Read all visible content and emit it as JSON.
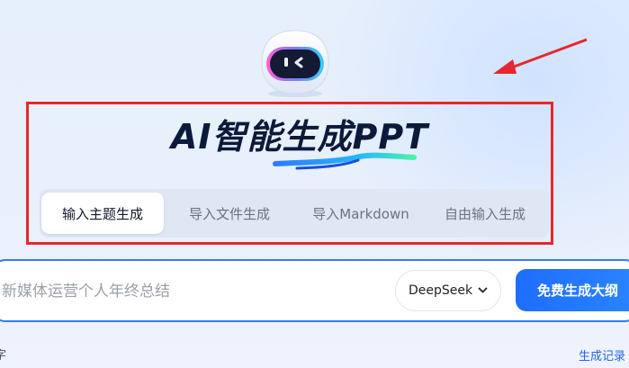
{
  "header": {
    "title": "AI智能生成PPT"
  },
  "tabs": [
    {
      "label": "输入主题生成",
      "active": true
    },
    {
      "label": "导入文件生成",
      "active": false
    },
    {
      "label": "导入Markdown",
      "active": false
    },
    {
      "label": "自由输入生成",
      "active": false
    }
  ],
  "prompt": {
    "placeholder": "新媒体运营个人年终总结"
  },
  "model_select": {
    "value": "DeepSeek",
    "icon": "chevron-down-icon"
  },
  "generate": {
    "label": "免费生成大纲"
  },
  "footer": {
    "left_text": "字",
    "history_link": "生成记录"
  },
  "colors": {
    "accent": "#2f7bff",
    "annotation_red": "#e8262b",
    "title": "#0c1a3a"
  }
}
